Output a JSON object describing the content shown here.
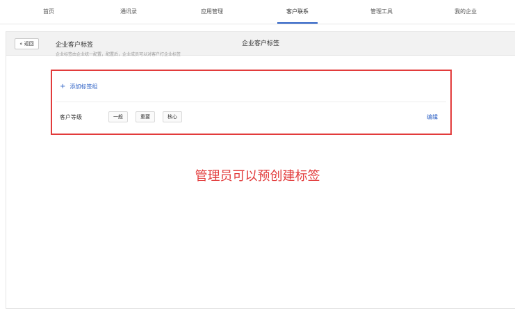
{
  "topnav": {
    "items": [
      {
        "label": "首页",
        "active": false
      },
      {
        "label": "通讯录",
        "active": false
      },
      {
        "label": "应用管理",
        "active": false
      },
      {
        "label": "客户联系",
        "active": true
      },
      {
        "label": "管理工具",
        "active": false
      },
      {
        "label": "我的企业",
        "active": false
      }
    ],
    "accent_color": "#2b5fc4"
  },
  "panel": {
    "back_label": "« 返回",
    "title": "企业客户标签"
  },
  "section": {
    "title": "企业客户标签",
    "description": "企业标签由企业统一配置，配置后，企业成员可以对客户打企业标签"
  },
  "tags": {
    "add_group_label": "添加标签组",
    "group_name": "客户等级",
    "values": [
      "一般",
      "重要",
      "核心"
    ],
    "edit_label": "编辑"
  },
  "annotation": {
    "text": "管理员可以预创建标签",
    "color": "#e23b3b"
  }
}
